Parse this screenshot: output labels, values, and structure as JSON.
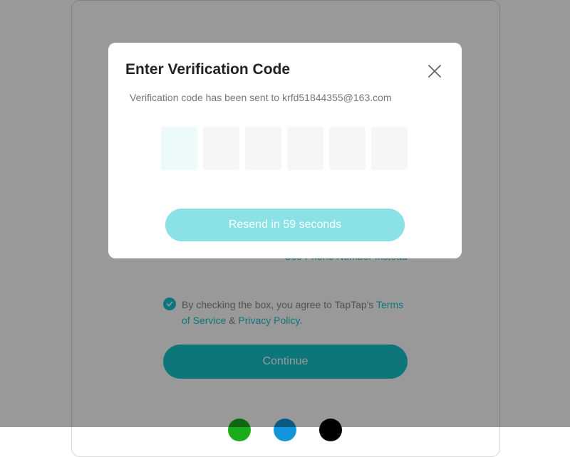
{
  "background": {
    "switch_link": "Use Phone Number Instead",
    "agreement": {
      "prefix": "By checking the box, you agree to TapTap's ",
      "terms": "Terms of Service",
      "amp": " & ",
      "privacy": "Privacy Policy",
      "suffix": "."
    },
    "continue_label": "Continue",
    "social": [
      "wechat-icon",
      "qq-icon",
      "apple-icon"
    ]
  },
  "modal": {
    "title": "Enter Verification Code",
    "subtitle": "Verification code has been sent to krfd51844355@163.com",
    "code_digits": [
      "",
      "",
      "",
      "",
      "",
      ""
    ],
    "resend_label": "Resend in 59 seconds"
  },
  "colors": {
    "accent": "#15c5ce",
    "overlay": "rgba(0,0,0,0.4)",
    "resend_disabled": "#8ae2e6"
  }
}
